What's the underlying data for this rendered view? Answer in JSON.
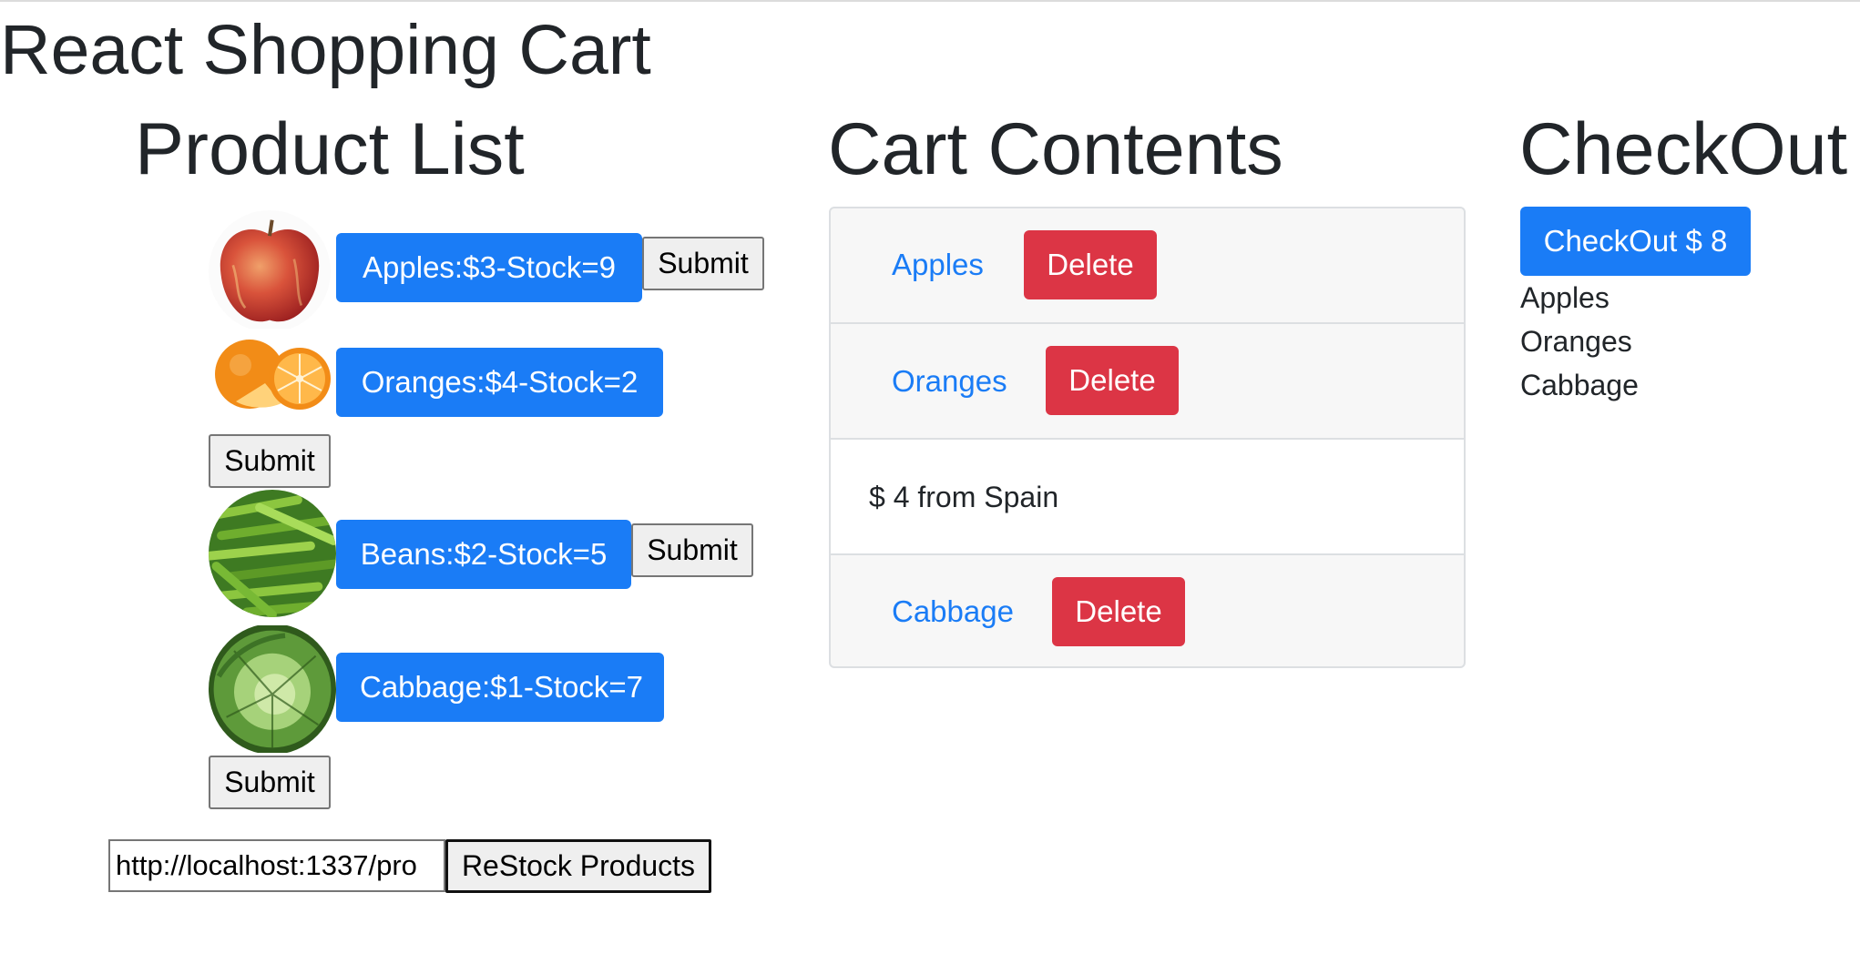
{
  "page": {
    "title": "React Shopping Cart"
  },
  "product_list": {
    "title": "Product List",
    "products": [
      {
        "label": "Apples:$3-Stock=9",
        "submit_label": "Submit",
        "image_icon": "apple-image"
      },
      {
        "label": "Oranges:$4-Stock=2",
        "submit_label": "Submit",
        "image_icon": "orange-image"
      },
      {
        "label": "Beans:$2-Stock=5",
        "submit_label": "Submit",
        "image_icon": "beans-image"
      },
      {
        "label": "Cabbage:$1-Stock=7",
        "submit_label": "Submit",
        "image_icon": "cabbage-image"
      }
    ],
    "restock": {
      "url_value": "http://localhost:1337/pro",
      "button_label": "ReStock Products"
    }
  },
  "cart": {
    "title": "Cart Contents",
    "items": [
      {
        "name": "Apples",
        "delete_label": "Delete"
      },
      {
        "name": "Oranges",
        "delete_label": "Delete",
        "details": "$ 4 from Spain"
      },
      {
        "name": "Cabbage",
        "delete_label": "Delete"
      }
    ]
  },
  "checkout": {
    "title": "CheckOut",
    "button_label": "CheckOut $ 8",
    "items": [
      "Apples",
      "Oranges",
      "Cabbage"
    ]
  },
  "colors": {
    "primary": "#1a7cf6",
    "danger": "#dc3545",
    "text": "#212529",
    "card_bg": "#f7f7f7",
    "border": "#dcdfe2"
  }
}
